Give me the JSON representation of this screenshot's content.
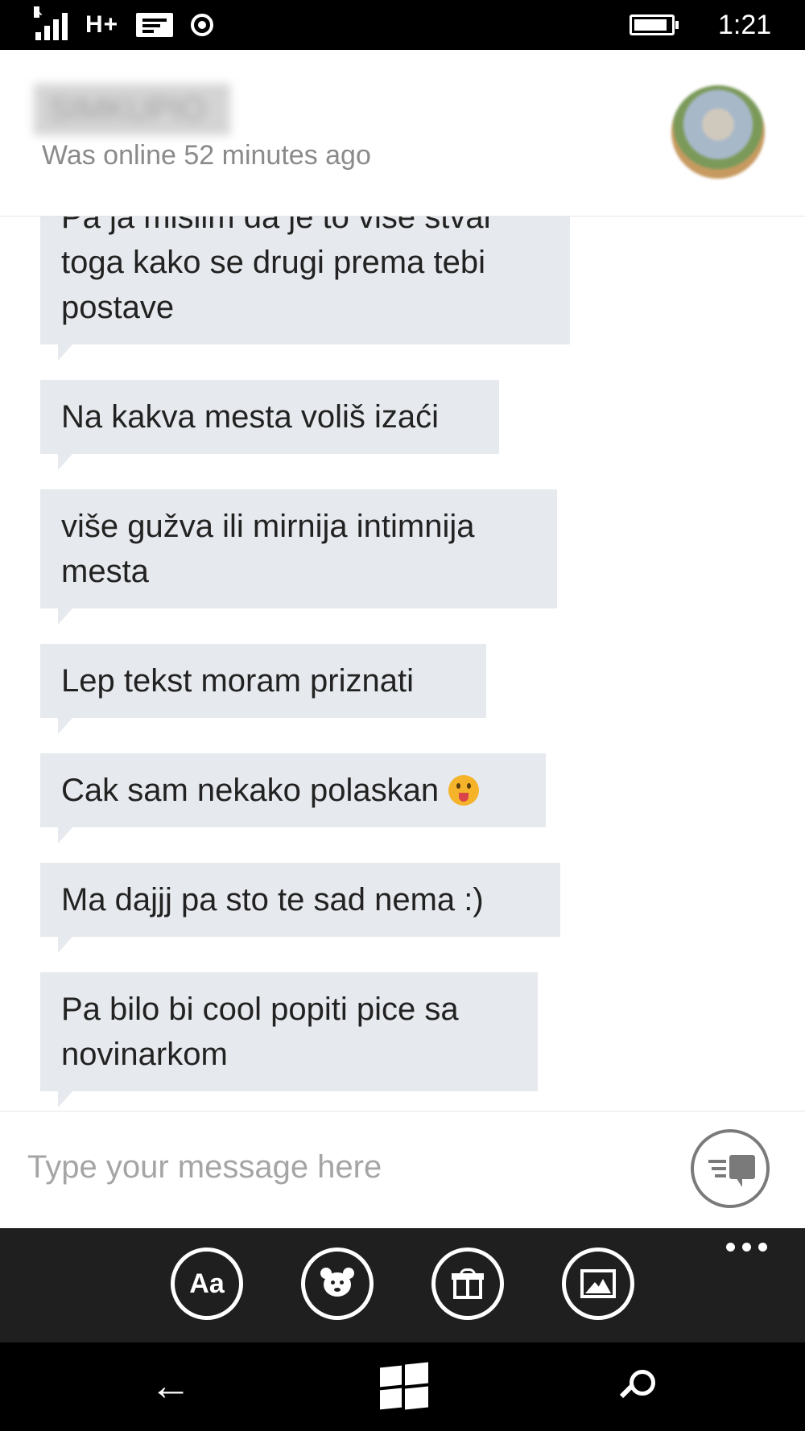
{
  "status_bar": {
    "network": "H+",
    "time": "1:21"
  },
  "header": {
    "contact_name": "SIMKUPIO",
    "presence": "Was online 52 minutes ago"
  },
  "messages": [
    "Pa ja mislim da je to više stvar toga kako se drugi prema tebi postave",
    "Na kakva mesta voliš izaći",
    "više gužva ili mirnija intimnija mesta",
    "Lep tekst moram priznati",
    "Cak sam nekako polaskan",
    "Ma dajjj pa sto te sad nema :)",
    "Pa bilo bi cool popiti pice sa novinarkom"
  ],
  "emoji_icon": "tongue-out-emoji-icon",
  "composer": {
    "placeholder": "Type your message here",
    "send_icon": "send-message-icon"
  },
  "appbar": {
    "font_button": "Aa",
    "icons": [
      "font-icon",
      "emoticon-icon",
      "gift-icon",
      "image-icon",
      "more-icon"
    ]
  },
  "navbar": {
    "icons": [
      "back-icon",
      "windows-start-icon",
      "search-icon"
    ]
  },
  "colors": {
    "bubble": "#e6e9ed",
    "appbar": "#1f1f1f",
    "placeholder": "#a5a5a5",
    "presence": "#8a8a8a"
  }
}
